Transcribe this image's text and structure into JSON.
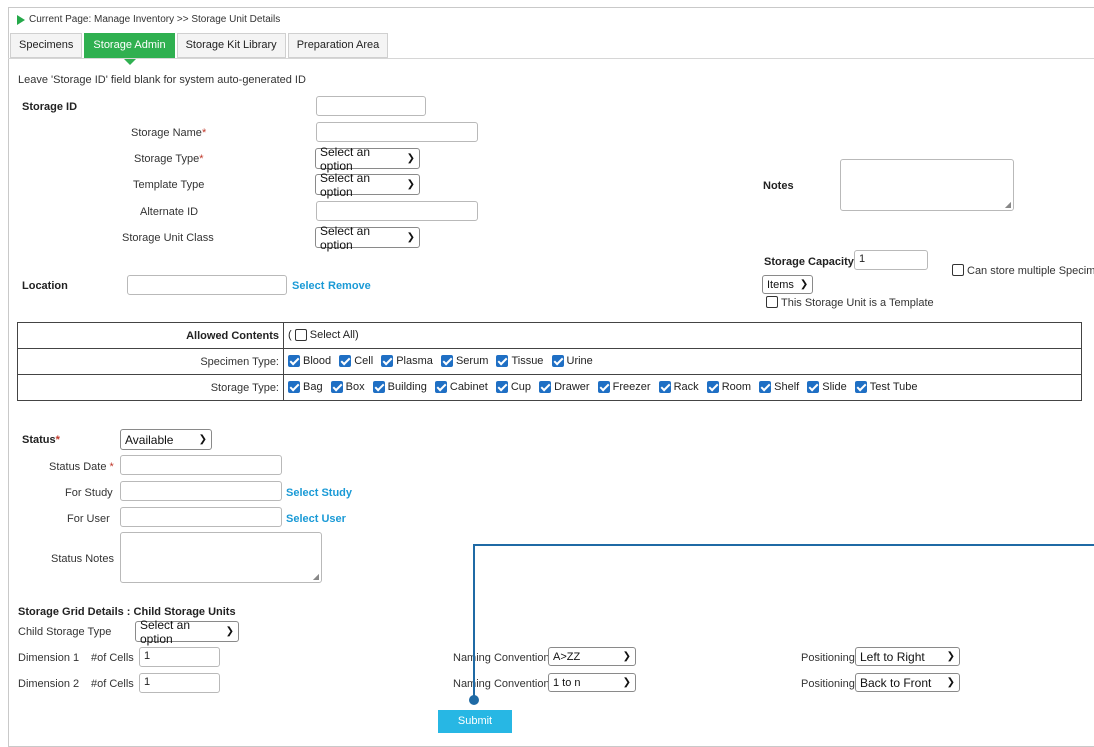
{
  "breadcrumb": "Current Page: Manage Inventory >> Storage Unit Details",
  "tabs": [
    {
      "label": "Specimens",
      "active": false
    },
    {
      "label": "Storage Admin",
      "active": true
    },
    {
      "label": "Storage Kit Library",
      "active": false
    },
    {
      "label": "Preparation Area",
      "active": false
    }
  ],
  "hint": "Leave 'Storage ID' field blank for system auto-generated ID",
  "form": {
    "storage_id_label": "Storage ID",
    "storage_name_label": "Storage Name",
    "storage_type_label": "Storage Type",
    "template_type_label": "Template Type",
    "alternate_id_label": "Alternate ID",
    "storage_unit_class_label": "Storage Unit Class",
    "select_option": "Select an option",
    "required_mark": "*",
    "notes_label": "Notes",
    "storage_capacity_label": "Storage Capacity",
    "storage_capacity_value": "1",
    "capacity_unit": "Items",
    "multiple_specimen_label": "Can store multiple Specimen",
    "template_checkbox_label": "This Storage Unit is a Template",
    "location_label": "Location",
    "location_select_link": "Select",
    "location_remove_link": "Remove"
  },
  "allowed_contents": {
    "label": "Allowed Contents",
    "select_all_prefix": "(",
    "select_all": "Select All)",
    "specimen_type_label": "Specimen Type:",
    "specimen_types": [
      "Blood",
      "Cell",
      "Plasma",
      "Serum",
      "Tissue",
      "Urine"
    ],
    "storage_type_label": "Storage Type:",
    "storage_types": [
      "Bag",
      "Box",
      "Building",
      "Cabinet",
      "Cup",
      "Drawer",
      "Freezer",
      "Rack",
      "Room",
      "Shelf",
      "Slide",
      "Test Tube"
    ]
  },
  "status": {
    "status_label": "Status",
    "status_value": "Available",
    "status_date_label": "Status Date",
    "for_study_label": "For Study",
    "select_study_link": "Select Study",
    "for_user_label": "For User",
    "select_user_link": "Select User",
    "status_notes_label": "Status Notes"
  },
  "grid": {
    "title": "Storage Grid Details : Child Storage Units",
    "child_type_label": "Child Storage Type",
    "child_type_value": "Select an option",
    "dim1_label": "Dimension 1",
    "dim2_label": "Dimension 2",
    "cells_label": "#of Cells",
    "dim1_cells": "1",
    "dim2_cells": "1",
    "naming_label": "Naming Convention",
    "naming1": "A>ZZ",
    "naming2": "1 to n",
    "positioning_label": "Positioning",
    "positioning1": "Left to Right",
    "positioning2": "Back to Front"
  },
  "submit_label": "Submit",
  "colors": {
    "accent_green": "#2fb050",
    "link_blue": "#1a9ad6",
    "submit_blue": "#27b7e4",
    "overlay_line": "#1f6aa5"
  }
}
